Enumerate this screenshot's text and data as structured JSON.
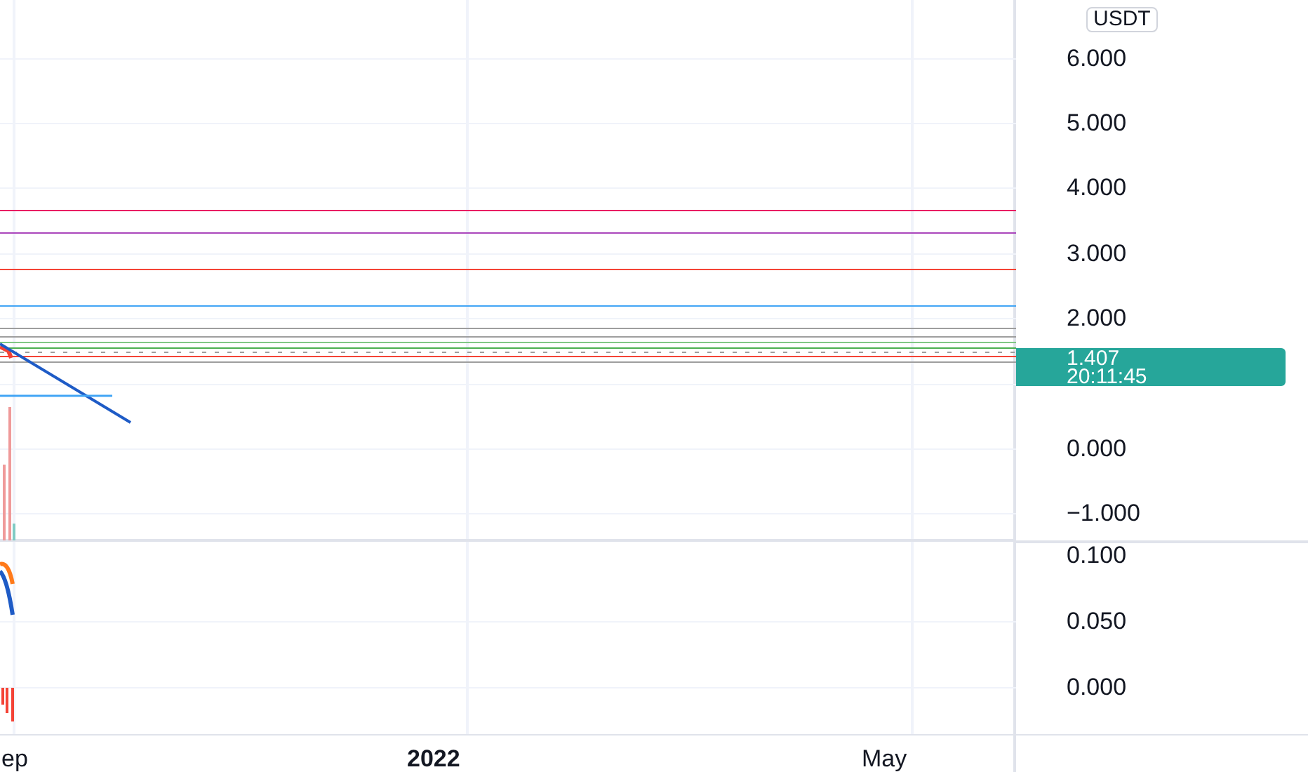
{
  "price_axis": {
    "currency": "USDT",
    "ticks": [
      "6.000",
      "5.000",
      "4.000",
      "3.000",
      "2.000",
      "0.000",
      "−1.000"
    ]
  },
  "last_price": {
    "price": "1.407",
    "countdown": "20:11:45"
  },
  "indicator_axis": {
    "ticks": [
      "0.100",
      "0.050",
      "0.000"
    ]
  },
  "time_axis": {
    "labels": [
      {
        "text": "ep",
        "kind": "month"
      },
      {
        "text": "2022",
        "kind": "year"
      },
      {
        "text": "May",
        "kind": "month"
      }
    ]
  }
}
